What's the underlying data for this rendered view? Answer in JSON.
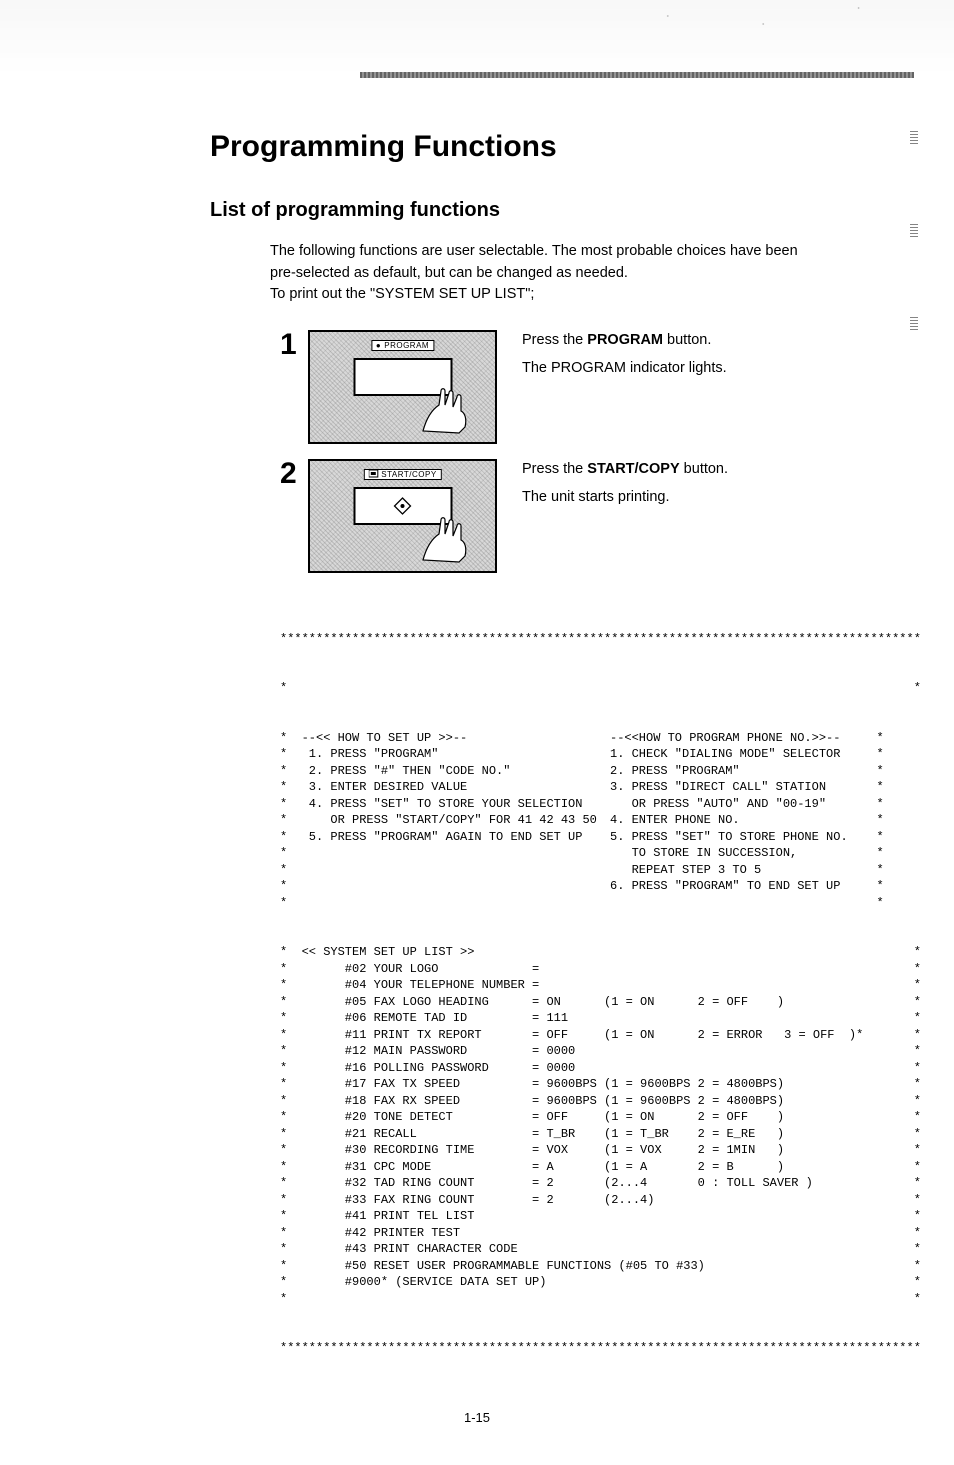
{
  "title": "Programming Functions",
  "subtitle": "List of programming functions",
  "intro": {
    "line1": "The following functions are user selectable. The most probable choices have been",
    "line2": "pre-selected as default, but can be changed as needed.",
    "line3": "To print out the \"SYSTEM SET UP LIST\";"
  },
  "steps": [
    {
      "num": "1",
      "label": "PROGRAM",
      "action_prefix": "Press the ",
      "action_bold": "PROGRAM",
      "action_suffix": " button.",
      "result": "The PROGRAM indicator lights."
    },
    {
      "num": "2",
      "label": "START/COPY",
      "action_prefix": "Press the ",
      "action_bold": "START/COPY",
      "action_suffix": " button.",
      "result": "The unit starts printing."
    }
  ],
  "printout": {
    "star_top": "*****************************************************************************************",
    "blank_star": "*                                                                                       *",
    "howto_left_title": "--<< HOW TO SET UP >>--",
    "howto_left": [
      "1. PRESS \"PROGRAM\"",
      "2. PRESS \"#\" THEN \"CODE NO.\"",
      "3. ENTER DESIRED VALUE",
      "4. PRESS \"SET\" TO STORE YOUR SELECTION",
      "   OR PRESS \"START/COPY\" FOR 41 42 43 50",
      "5. PRESS \"PROGRAM\" AGAIN TO END SET UP"
    ],
    "howto_right_title": "--<<HOW TO PROGRAM PHONE NO.>>--",
    "howto_right": [
      "1. CHECK \"DIALING MODE\" SELECTOR",
      "2. PRESS \"PROGRAM\"",
      "3. PRESS \"DIRECT CALL\" STATION",
      "   OR PRESS \"AUTO\" AND \"00-19\"",
      "4. ENTER PHONE NO.",
      "5. PRESS \"SET\" TO STORE PHONE NO.",
      "   TO STORE IN SUCCESSION,",
      "   REPEAT STEP 3 TO 5",
      "6. PRESS \"PROGRAM\" TO END SET UP"
    ],
    "list_title": "<< SYSTEM SET UP LIST >>",
    "items": [
      "#02 YOUR LOGO             =",
      "#04 YOUR TELEPHONE NUMBER =",
      "#05 FAX LOGO HEADING      = ON      (1 = ON      2 = OFF    )",
      "#06 REMOTE TAD ID         = 111",
      "#11 PRINT TX REPORT       = OFF     (1 = ON      2 = ERROR   3 = OFF  )*",
      "#12 MAIN PASSWORD         = 0000",
      "#16 POLLING PASSWORD      = 0000",
      "#17 FAX TX SPEED          = 9600BPS (1 = 9600BPS 2 = 4800BPS)",
      "#18 FAX RX SPEED          = 9600BPS (1 = 9600BPS 2 = 4800BPS)",
      "#20 TONE DETECT           = OFF     (1 = ON      2 = OFF    )",
      "#21 RECALL                = T_BR    (1 = T_BR    2 = E_RE   )",
      "#30 RECORDING TIME        = VOX     (1 = VOX     2 = 1MIN   )",
      "#31 CPC MODE              = A       (1 = A       2 = B      )",
      "#32 TAD RING COUNT        = 2       (2...4       0 : TOLL SAVER )",
      "#33 FAX RING COUNT        = 2       (2...4)",
      "#41 PRINT TEL LIST",
      "#42 PRINTER TEST",
      "#43 PRINT CHARACTER CODE",
      "#50 RESET USER PROGRAMMABLE FUNCTIONS (#05 TO #33)",
      "#9000* (SERVICE DATA SET UP)"
    ],
    "star_bottom": "*****************************************************************************************"
  },
  "page_number": "1-15"
}
